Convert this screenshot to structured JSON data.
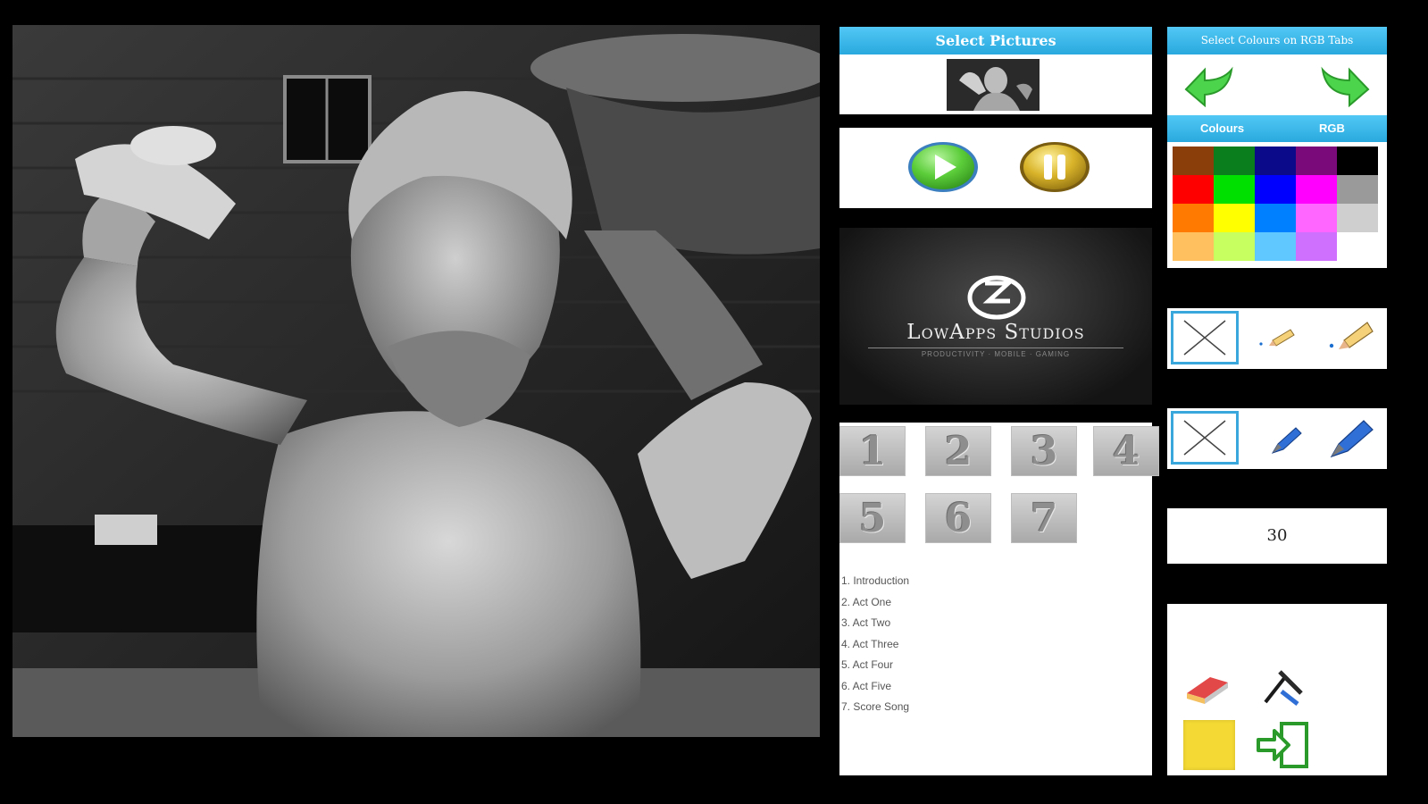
{
  "select_pictures": {
    "title": "Select Pictures"
  },
  "logo": {
    "name": "LowApps Studios",
    "tagline": "PRODUCTIVITY · MOBILE · GAMING"
  },
  "scenes": {
    "tiles": [
      "1",
      "2",
      "3",
      "4",
      "5",
      "6",
      "7"
    ],
    "list": [
      "1. Introduction",
      "2. Act One",
      "3. Act Two",
      "4. Act Three",
      "5. Act Four",
      "6. Act Five",
      "7. Score Song"
    ]
  },
  "colour_panel": {
    "title": "Select Colours on RGB Tabs",
    "tabs": [
      "Colours",
      "RGB"
    ],
    "palette": [
      [
        "#8a3e0a",
        "#0a7d1c",
        "#0a0a8a",
        "#7a0a7a",
        "#000000"
      ],
      [
        "#ff0000",
        "#00e000",
        "#0000ff",
        "#ff00ff",
        "#9a9a9a"
      ],
      [
        "#ff7a00",
        "#ffff00",
        "#0080ff",
        "#ff66ff",
        "#cfcfcf"
      ],
      [
        "#ffc060",
        "#c8ff60",
        "#60c8ff",
        "#d070ff",
        "#ffffff"
      ]
    ]
  },
  "brush_size": {
    "value": "30"
  }
}
